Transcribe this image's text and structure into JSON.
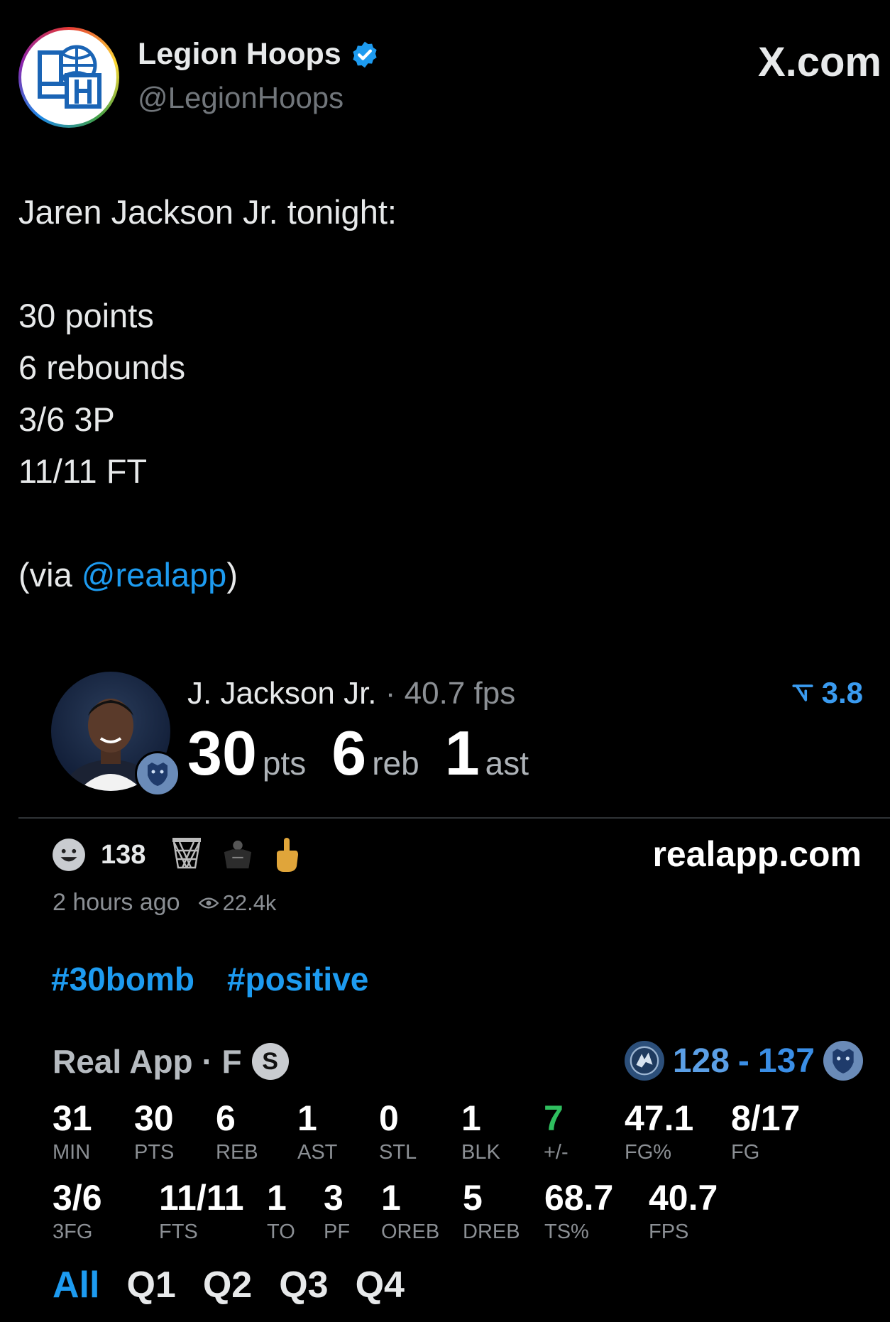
{
  "tweet": {
    "display_name": "Legion Hoops",
    "handle": "@LegionHoops",
    "source_brand": "X.com",
    "lines": [
      "Jaren Jackson Jr. tonight:",
      "",
      "30 points",
      "6 rebounds",
      "3/6 3P",
      "11/11 FT",
      ""
    ],
    "via_prefix": "(via ",
    "via_mention": "@realapp",
    "via_suffix": ")"
  },
  "card": {
    "player_name": "J. Jackson Jr.",
    "fps_label": "· 40.7 fps",
    "trend_value": "3.8",
    "headline": [
      {
        "value": "30",
        "unit": "pts"
      },
      {
        "value": "6",
        "unit": "reb"
      },
      {
        "value": "1",
        "unit": "ast"
      }
    ],
    "reaction_count": "138",
    "link": "realapp.com",
    "time_ago": "2 hours ago",
    "views": "22.4k",
    "hashtags": [
      "#30bomb",
      "#positive"
    ],
    "source_label": "Real App · F",
    "source_badge": "S",
    "score_away": "128",
    "score_sep": "-",
    "score_home": "137"
  },
  "stats_row1": [
    {
      "value": "31",
      "label": "MIN"
    },
    {
      "value": "30",
      "label": "PTS"
    },
    {
      "value": "6",
      "label": "REB"
    },
    {
      "value": "1",
      "label": "AST"
    },
    {
      "value": "0",
      "label": "STL"
    },
    {
      "value": "1",
      "label": "BLK"
    },
    {
      "value": "7",
      "label": "+/-"
    },
    {
      "value": "47.1",
      "label": "FG%"
    },
    {
      "value": "8/17",
      "label": "FG"
    }
  ],
  "stats_row2": [
    {
      "value": "3/6",
      "label": "3FG"
    },
    {
      "value": "11/11",
      "label": "FTS"
    },
    {
      "value": "1",
      "label": "TO"
    },
    {
      "value": "3",
      "label": "PF"
    },
    {
      "value": "1",
      "label": "OREB"
    },
    {
      "value": "5",
      "label": "DREB"
    },
    {
      "value": "68.7",
      "label": "TS%"
    },
    {
      "value": "40.7",
      "label": "FPS"
    }
  ],
  "tabs": [
    "All",
    "Q1",
    "Q2",
    "Q3",
    "Q4"
  ],
  "colors": {
    "accent": "#1d9bf0",
    "positive": "#2fbf5f",
    "verified": "#1d9bf0"
  },
  "icons": [
    "verified-badge-icon",
    "grin-face-icon",
    "basketball-net-icon",
    "player-jersey-icon",
    "finger-hand-icon",
    "eye-icon",
    "trend-down-icon",
    "timberwolves-logo-icon",
    "grizzlies-logo-icon"
  ]
}
